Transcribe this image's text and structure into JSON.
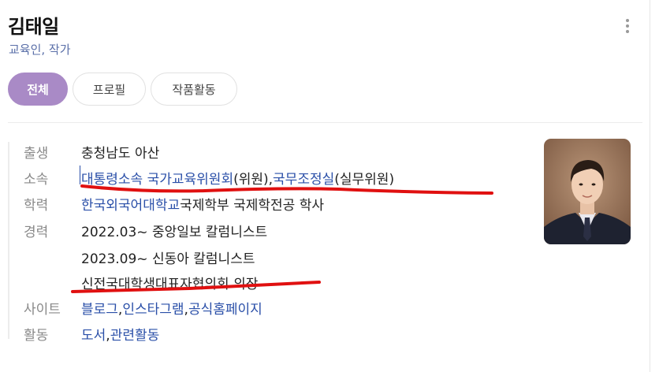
{
  "person": {
    "name": "김태일",
    "subtitle": "교육인, 작가"
  },
  "tabs": [
    "전체",
    "프로필",
    "작품활동"
  ],
  "profile": {
    "birth": {
      "label": "출생",
      "value": "충청남도 아산"
    },
    "affiliation": {
      "label": "소속",
      "link1": "대통령소속 국가교육위원회",
      "text1": "(위원), ",
      "link2": "국무조정실",
      "text2": "(실무위원)"
    },
    "education": {
      "label": "학력",
      "link": "한국외국어대학교",
      "text": " 국제학부 국제학전공 학사"
    },
    "career": {
      "label": "경력",
      "items": [
        "2022.03~ 중앙일보 칼럼니스트",
        "2023.09~ 신동아 칼럼니스트",
        "신전국대학생대표자협의회 의장"
      ]
    },
    "site": {
      "label": "사이트",
      "links": [
        "블로그",
        "인스타그램",
        "공식홈페이지"
      ],
      "sep": ", "
    },
    "activity": {
      "label": "활동",
      "links": [
        "도서",
        "관련활동"
      ],
      "sep": ", "
    }
  },
  "colors": {
    "accent": "#a98ac6",
    "link": "#2a4fa8",
    "annotation": "#e01010"
  },
  "icons": {
    "more": "more-vertical-icon"
  }
}
